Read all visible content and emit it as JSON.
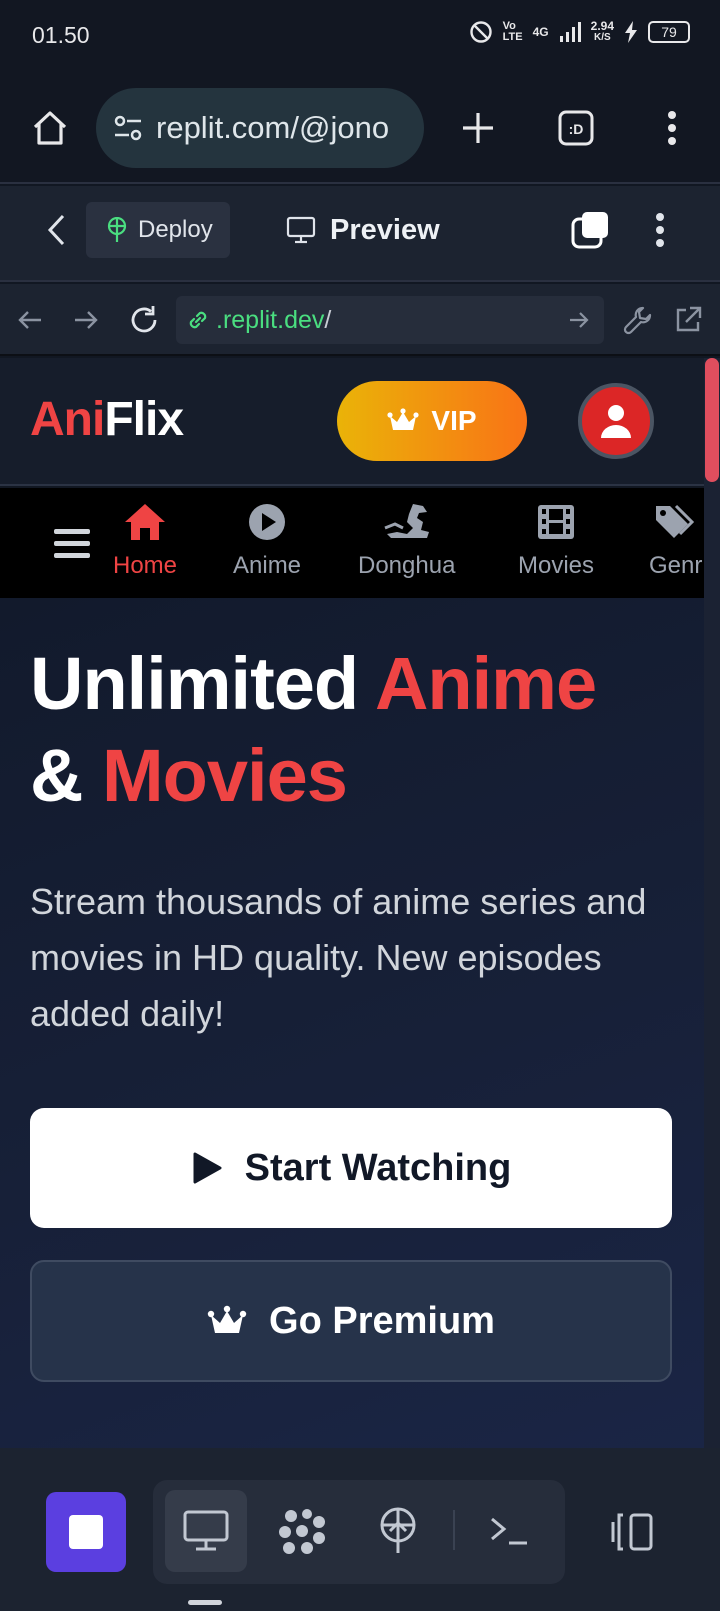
{
  "status_bar": {
    "time": "01.50",
    "network": "4G",
    "speed": "2.94",
    "speed_unit": "K/S",
    "battery": "79"
  },
  "browser": {
    "url_display": "replit.com/@jono"
  },
  "replit_bar": {
    "deploy_label": "Deploy",
    "preview_label": "Preview"
  },
  "webview": {
    "address_domain": ".replit.dev",
    "address_path": "/"
  },
  "site": {
    "logo_part1": "Ani",
    "logo_part2": "Flix",
    "vip_label": "VIP",
    "nav": [
      {
        "label": "Home",
        "icon": "home-icon",
        "active": true
      },
      {
        "label": "Anime",
        "icon": "play-circle-icon",
        "active": false
      },
      {
        "label": "Donghua",
        "icon": "dragon-icon",
        "active": false
      },
      {
        "label": "Movies",
        "icon": "film-icon",
        "active": false
      },
      {
        "label": "Genr",
        "icon": "tags-icon",
        "active": false
      }
    ],
    "hero": {
      "title_1": "Unlimited",
      "title_2": "Anime",
      "title_3": "&",
      "title_4": "Movies",
      "subtitle": "Stream thousands of anime series and movies in HD quality. New episodes added daily!",
      "start_label": "Start Watching",
      "premium_label": "Go Premium"
    }
  },
  "colors": {
    "accent_red": "#ef4444",
    "vip_from": "#eab308",
    "vip_to": "#f97316",
    "stop_purple": "#5b3fe0"
  }
}
